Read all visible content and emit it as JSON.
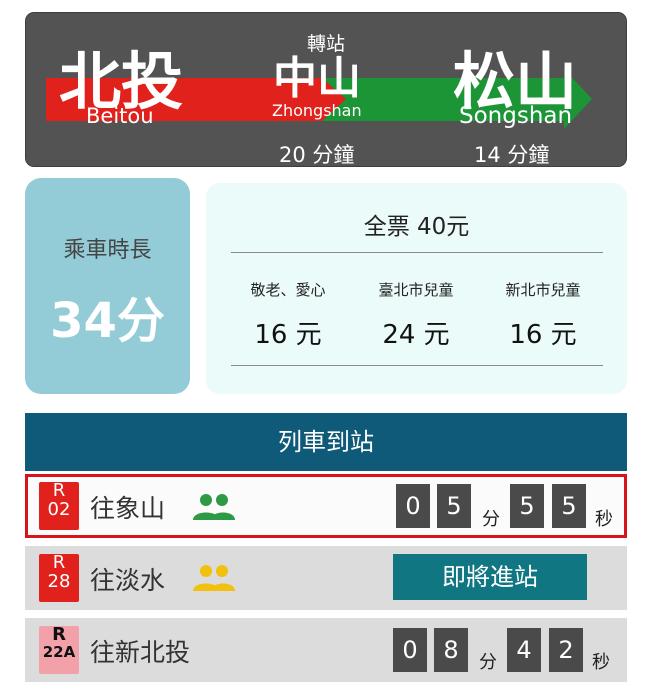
{
  "route": {
    "origin": {
      "zh": "北投",
      "en": "Beitou"
    },
    "transfer": {
      "label": "轉站",
      "zh": "中山",
      "en": "Zhongshan",
      "duration": "20 分鐘"
    },
    "destination": {
      "zh": "松山",
      "en": "Songshan",
      "duration": "14 分鐘"
    },
    "line_colors": [
      "#e0211c",
      "#1b9536"
    ]
  },
  "ride": {
    "label": "乘車時長",
    "value": "34分"
  },
  "fare": {
    "full": "全票 40元",
    "categories": [
      {
        "label": "敬老、愛心",
        "amount": "16 元"
      },
      {
        "label": "臺北市兒童",
        "amount": "24 元"
      },
      {
        "label": "新北市兒童",
        "amount": "16 元"
      }
    ]
  },
  "arrivals": {
    "header": "列車到站",
    "rows": [
      {
        "code_top": "R",
        "code_bottom": "02",
        "badge_color": "#e0211c",
        "destination": "往象山",
        "crowd_icon": "people-icon-green",
        "crowd_color": "#2e9a46",
        "digits": [
          "0",
          "5",
          "5",
          "5"
        ],
        "min_unit": "分",
        "sec_unit": "秒"
      },
      {
        "code_top": "R",
        "code_bottom": "28",
        "badge_color": "#e0211c",
        "destination": "往淡水",
        "crowd_icon": "people-icon-yellow",
        "crowd_color": "#f2c10f",
        "status": "即將進站"
      },
      {
        "code_top": "R",
        "code_bottom": "22A",
        "badge_color": "#f3a1a9",
        "destination": "往新北投",
        "digits": [
          "0",
          "8",
          "4",
          "2"
        ],
        "min_unit": "分",
        "sec_unit": "秒"
      }
    ]
  }
}
